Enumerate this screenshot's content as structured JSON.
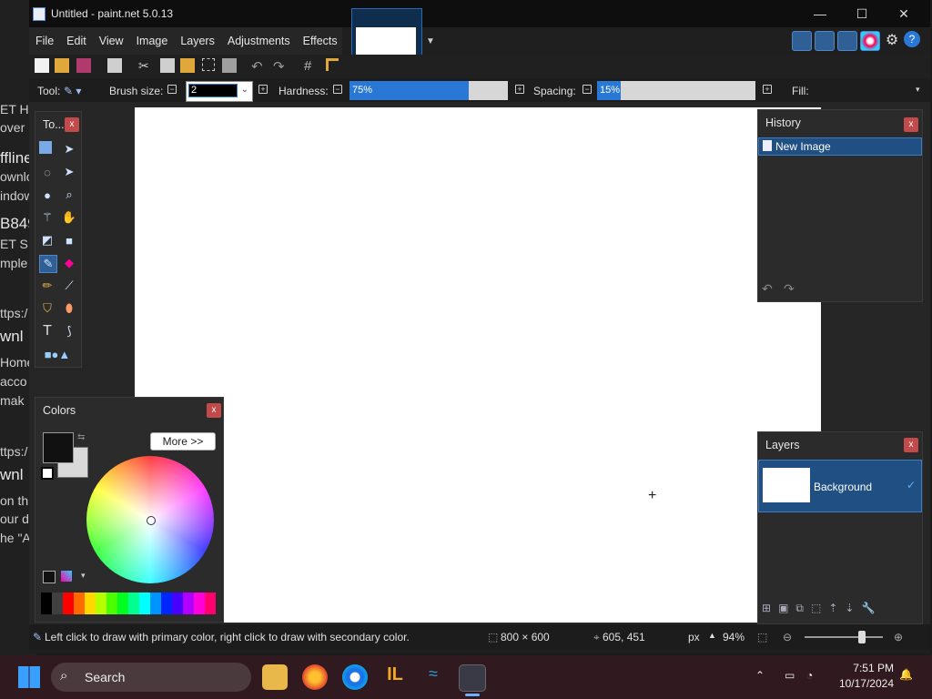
{
  "background_page": {
    "fragments": [
      "ET H",
      "over",
      "ffline",
      "ownlo",
      "indow",
      "B849",
      "ET S",
      "mple",
      "ttps:/",
      "wnl",
      "Home",
      "acco",
      "mak",
      "ttps:/",
      "wnl",
      "on th",
      "our d",
      "he \"A"
    ]
  },
  "window": {
    "title": "Untitled - paint.net 5.0.13",
    "controls": {
      "minimize": "—",
      "maximize": "☐",
      "close": "✕"
    }
  },
  "menu": [
    "File",
    "Edit",
    "View",
    "Image",
    "Layers",
    "Adjustments",
    "Effects"
  ],
  "options_bar": {
    "tool_label": "Tool:",
    "brush_size_label": "Brush size:",
    "brush_size_value": "2",
    "hardness_label": "Hardness:",
    "hardness_value": "75%",
    "hardness_fraction": 0.75,
    "spacing_label": "Spacing:",
    "spacing_value": "15%",
    "spacing_fraction": 0.15,
    "fill_label": "Fill:"
  },
  "tools_panel": {
    "title": "To..."
  },
  "colors_panel": {
    "title": "Colors",
    "more_button": "More >>",
    "primary_color": "#111111",
    "secondary_color": "#d9d9d9",
    "palette": [
      "#000000",
      "#404040",
      "#ff0000",
      "#ff6a00",
      "#ffd800",
      "#b6ff00",
      "#4cff00",
      "#00ff21",
      "#00ff90",
      "#00ffff",
      "#0094ff",
      "#0026ff",
      "#4800ff",
      "#b200ff",
      "#ff00dc",
      "#ff006e"
    ]
  },
  "history_panel": {
    "title": "History",
    "items": [
      "New Image"
    ]
  },
  "layers_panel": {
    "title": "Layers",
    "items": [
      {
        "name": "Background",
        "visible": "✓"
      }
    ]
  },
  "status": {
    "hint": "Left click to draw with primary color, right click to draw with secondary color.",
    "image_size": "800 × 600",
    "cursor_pos": "605, 451",
    "units": "px",
    "zoom": "94%"
  },
  "taskbar": {
    "search_label": "Search",
    "time": "7:51 PM",
    "date": "10/17/2024"
  },
  "colors": {
    "accent": "#2a78d6",
    "close_red": "#c24a4a"
  }
}
